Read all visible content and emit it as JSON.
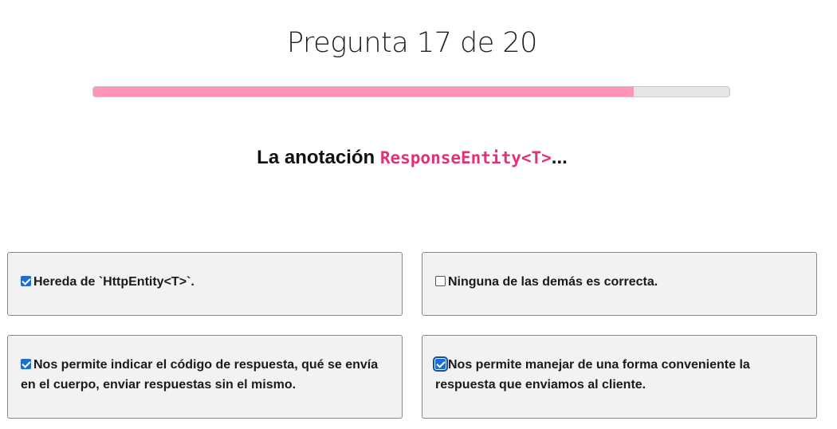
{
  "header": {
    "counter": "Pregunta 17 de 20",
    "progress_percent": 85
  },
  "question": {
    "prefix": "La anotación ",
    "code": "ResponseEntity<T>",
    "suffix": "..."
  },
  "options": [
    {
      "label": "Hereda de `HttpEntity<T>`.",
      "checked": true
    },
    {
      "label": "Ninguna de las demás es correcta.",
      "checked": false
    },
    {
      "label": "Nos permite indicar el código de respuesta, qué se envía en el cuerpo, enviar respuestas sin el mismo.",
      "checked": true
    },
    {
      "label": "Nos permite manejar de una forma conveniente la respuesta que enviamos al cliente.",
      "checked": true,
      "focused": true
    }
  ],
  "colors": {
    "progress_fill": "#ff94b8",
    "code_text": "#e0327a",
    "checkbox_checked": "#1a6fd1"
  }
}
